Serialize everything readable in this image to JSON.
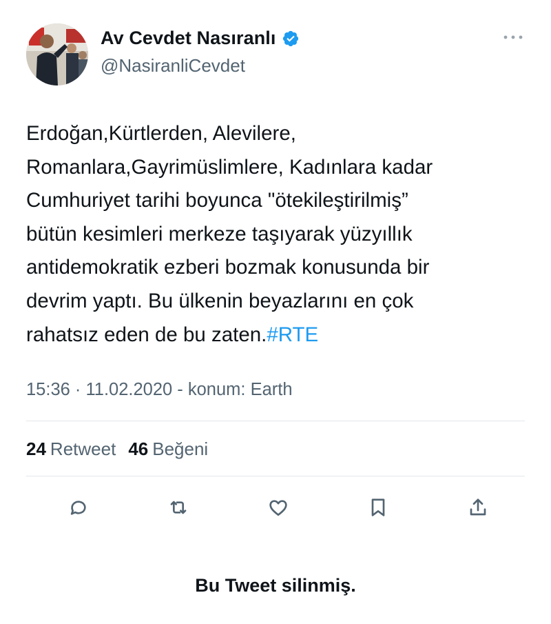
{
  "author": {
    "name": "Av Cevdet Nasıranlı",
    "handle": "@NasiranliCevdet",
    "avatar_icon": "profile-photo",
    "verified_icon": "verified-badge-icon",
    "verified_color": "#1d9bf0"
  },
  "more_icon": "more-dots-icon",
  "tweet": {
    "lines": [
      "Erdoğan,Kürtlerden, Alevilere,",
      "Romanlara,Gayrimüslimlere, Kadınlara kadar",
      "Cumhuriyet tarihi boyunca \"ötekileştirilmiş”",
      "bütün kesimleri merkeze taşıyarak yüzyıllık",
      "antidemokratik ezberi bozmak konusunda bir",
      "devrim yaptı. Bu ülkenin beyazlarını en çok",
      "rahatsız eden de bu zaten."
    ],
    "hashtag": "#RTE",
    "hashtag_color": "#1d9bf0"
  },
  "meta": {
    "timestamp": "15:36 · 11.02.2020 - konum: Earth"
  },
  "stats": {
    "retweet_count": "24",
    "retweet_label": "Retweet",
    "like_count": "46",
    "like_label": "Beğeni"
  },
  "actions": [
    {
      "icon": "reply-icon"
    },
    {
      "icon": "retweet-icon"
    },
    {
      "icon": "like-icon"
    },
    {
      "icon": "bookmark-icon"
    },
    {
      "icon": "share-icon"
    }
  ],
  "deleted_note": "Bu Tweet silinmiş.",
  "colors": {
    "text": "#0f1419",
    "secondary": "#536471",
    "divider": "#e3e6e9"
  }
}
